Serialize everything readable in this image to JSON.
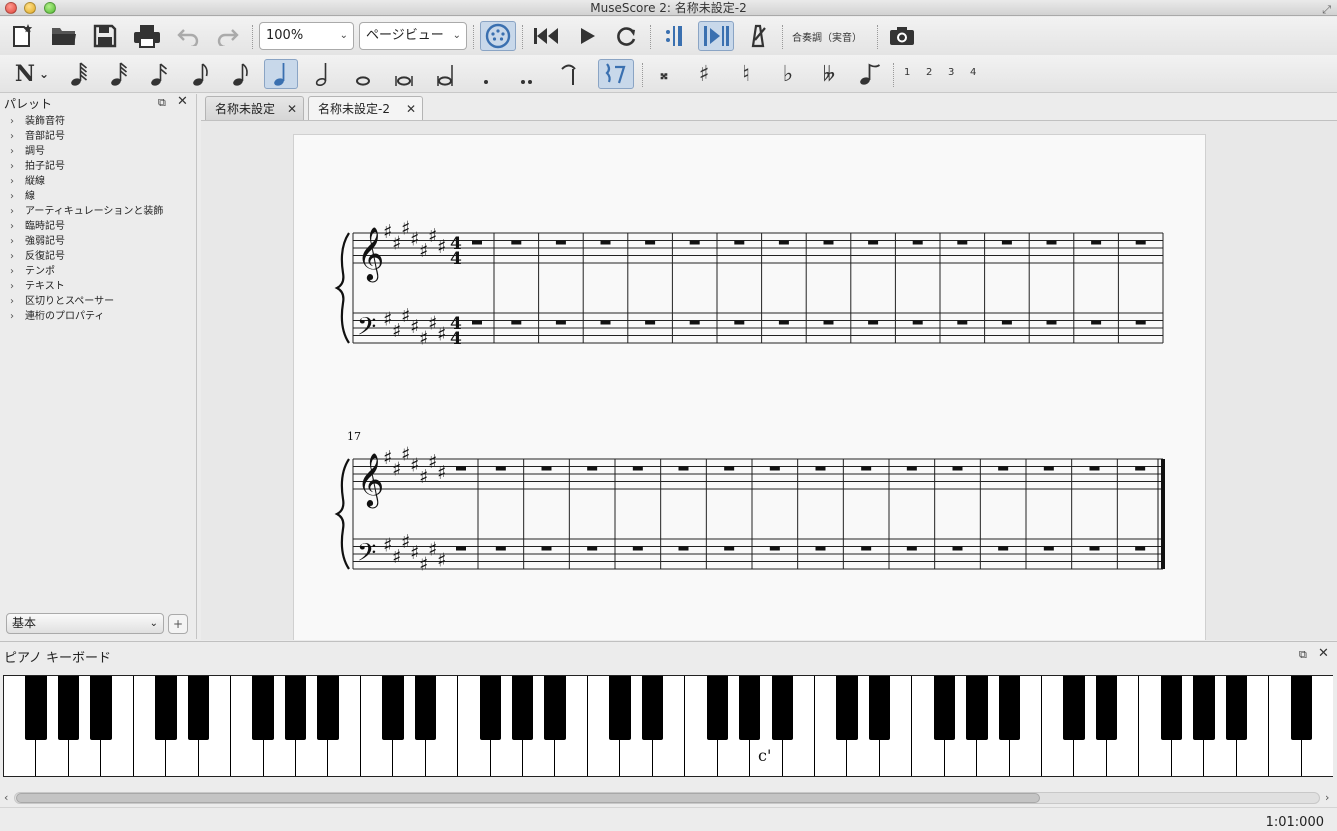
{
  "window": {
    "title": "MuseScore 2: 名称未設定-2"
  },
  "toolbar": {
    "zoom": "100%",
    "view_mode": "ページビュー",
    "concert_pitch": "合奏調（実音）"
  },
  "note_input": {
    "voices": [
      "1",
      "2",
      "3",
      "4"
    ]
  },
  "palette": {
    "title": "パレット",
    "items": [
      "装飾音符",
      "音部記号",
      "調号",
      "拍子記号",
      "縦線",
      "線",
      "アーティキュレーションと装飾",
      "臨時記号",
      "強弱記号",
      "反復記号",
      "テンポ",
      "テキスト",
      "区切りとスペーサー",
      "連桁のプロパティ"
    ],
    "workspace": "基本",
    "add_label": "+"
  },
  "tabs": [
    {
      "label": "名称未設定"
    },
    {
      "label": "名称未設定-2"
    }
  ],
  "score": {
    "time_signature": "4/4",
    "key_sharps": 7,
    "system2_start_measure": "17"
  },
  "piano": {
    "title": "ピアノ キーボード",
    "key_label": "c'"
  },
  "status": {
    "position": "1:01:000"
  }
}
